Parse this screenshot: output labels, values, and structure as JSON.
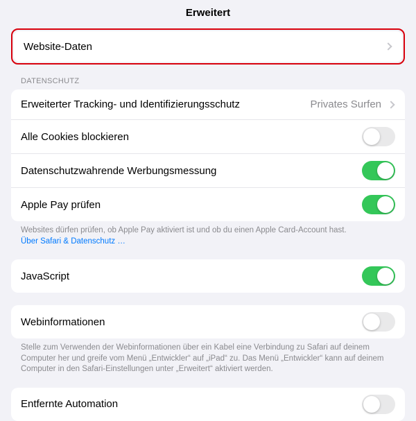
{
  "title": "Erweitert",
  "websiteData": {
    "label": "Website-Daten"
  },
  "privacy": {
    "header": "DATENSCHUTZ",
    "tracking": {
      "label": "Erweiterter Tracking- und Identifizierungsschutz",
      "detail": "Privates Surfen"
    },
    "blockCookies": {
      "label": "Alle Cookies blockieren",
      "value": false
    },
    "adMeasurement": {
      "label": "Datenschutzwahrende Werbungsmessung",
      "value": true
    },
    "applePay": {
      "label": "Apple Pay prüfen",
      "value": true
    },
    "footerText": "Websites dürfen prüfen, ob Apple Pay aktiviert ist und ob du einen Apple Card-Account hast.",
    "footerLink": "Über Safari & Datenschutz …"
  },
  "javascript": {
    "label": "JavaScript",
    "value": true
  },
  "webInspector": {
    "label": "Webinformationen",
    "value": false,
    "footer": "Stelle zum Verwenden der Webinformationen über ein Kabel eine Verbindung zu Safari auf deinem Computer her und greife vom Menü „Entwickler“ auf „iPad“ zu. Das Menü „Entwickler“ kann auf deinem Computer in den Safari-Einstellungen unter „Erweitert“ aktiviert werden."
  },
  "remoteAutomation": {
    "label": "Entfernte Automation",
    "value": false
  },
  "toggleStates": {
    "true": "on",
    "false": "off"
  }
}
